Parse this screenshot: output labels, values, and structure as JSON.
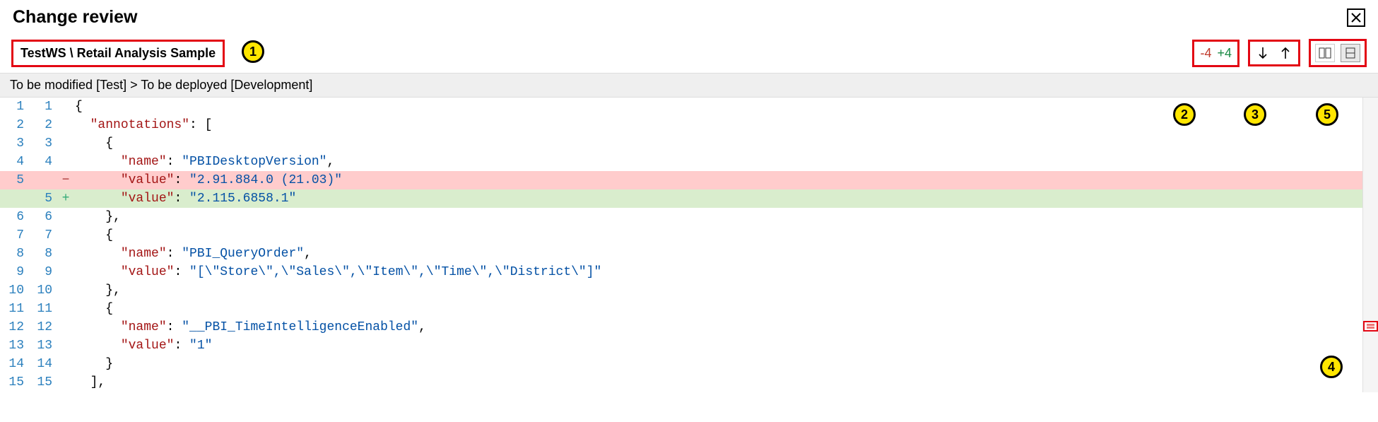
{
  "header": {
    "title": "Change review"
  },
  "breadcrumb": "TestWS \\ Retail Analysis Sample",
  "counts": {
    "removed": "-4",
    "added": "+4"
  },
  "subheader": "To be modified [Test] > To be deployed [Development]",
  "callouts": {
    "c1": "1",
    "c2": "2",
    "c3": "3",
    "c4": "4",
    "c5": "5"
  },
  "diff": [
    {
      "old": "1",
      "new": "1",
      "type": "ctx",
      "tokens": [
        [
          "punct",
          "{"
        ]
      ]
    },
    {
      "old": "2",
      "new": "2",
      "type": "ctx",
      "tokens": [
        [
          "punct",
          "  "
        ],
        [
          "key",
          "\"annotations\""
        ],
        [
          "punct",
          ": ["
        ]
      ]
    },
    {
      "old": "3",
      "new": "3",
      "type": "ctx",
      "tokens": [
        [
          "punct",
          "    {"
        ]
      ]
    },
    {
      "old": "4",
      "new": "4",
      "type": "ctx",
      "tokens": [
        [
          "punct",
          "      "
        ],
        [
          "key",
          "\"name\""
        ],
        [
          "punct",
          ": "
        ],
        [
          "str",
          "\"PBIDesktopVersion\""
        ],
        [
          "punct",
          ","
        ]
      ]
    },
    {
      "old": "5",
      "new": "",
      "type": "del",
      "tokens": [
        [
          "punct",
          "      "
        ],
        [
          "key",
          "\"value\""
        ],
        [
          "punct",
          ": "
        ],
        [
          "str",
          "\"2.91.884.0 (21.03)\""
        ]
      ]
    },
    {
      "old": "",
      "new": "5",
      "type": "add",
      "tokens": [
        [
          "punct",
          "      "
        ],
        [
          "key",
          "\"value\""
        ],
        [
          "punct",
          ": "
        ],
        [
          "str",
          "\"2.115.6858.1\""
        ]
      ]
    },
    {
      "old": "6",
      "new": "6",
      "type": "ctx",
      "tokens": [
        [
          "punct",
          "    },"
        ]
      ]
    },
    {
      "old": "7",
      "new": "7",
      "type": "ctx",
      "tokens": [
        [
          "punct",
          "    {"
        ]
      ]
    },
    {
      "old": "8",
      "new": "8",
      "type": "ctx",
      "tokens": [
        [
          "punct",
          "      "
        ],
        [
          "key",
          "\"name\""
        ],
        [
          "punct",
          ": "
        ],
        [
          "str",
          "\"PBI_QueryOrder\""
        ],
        [
          "punct",
          ","
        ]
      ]
    },
    {
      "old": "9",
      "new": "9",
      "type": "ctx",
      "tokens": [
        [
          "punct",
          "      "
        ],
        [
          "key",
          "\"value\""
        ],
        [
          "punct",
          ": "
        ],
        [
          "str",
          "\"[\\\"Store\\\",\\\"Sales\\\",\\\"Item\\\",\\\"Time\\\",\\\"District\\\"]\""
        ]
      ]
    },
    {
      "old": "10",
      "new": "10",
      "type": "ctx",
      "tokens": [
        [
          "punct",
          "    },"
        ]
      ]
    },
    {
      "old": "11",
      "new": "11",
      "type": "ctx",
      "tokens": [
        [
          "punct",
          "    {"
        ]
      ]
    },
    {
      "old": "12",
      "new": "12",
      "type": "ctx",
      "tokens": [
        [
          "punct",
          "      "
        ],
        [
          "key",
          "\"name\""
        ],
        [
          "punct",
          ": "
        ],
        [
          "str",
          "\"__PBI_TimeIntelligenceEnabled\""
        ],
        [
          "punct",
          ","
        ]
      ]
    },
    {
      "old": "13",
      "new": "13",
      "type": "ctx",
      "tokens": [
        [
          "punct",
          "      "
        ],
        [
          "key",
          "\"value\""
        ],
        [
          "punct",
          ": "
        ],
        [
          "str",
          "\"1\""
        ]
      ]
    },
    {
      "old": "14",
      "new": "14",
      "type": "ctx",
      "tokens": [
        [
          "punct",
          "    }"
        ]
      ]
    },
    {
      "old": "15",
      "new": "15",
      "type": "ctx",
      "tokens": [
        [
          "punct",
          "  ],"
        ]
      ]
    }
  ]
}
